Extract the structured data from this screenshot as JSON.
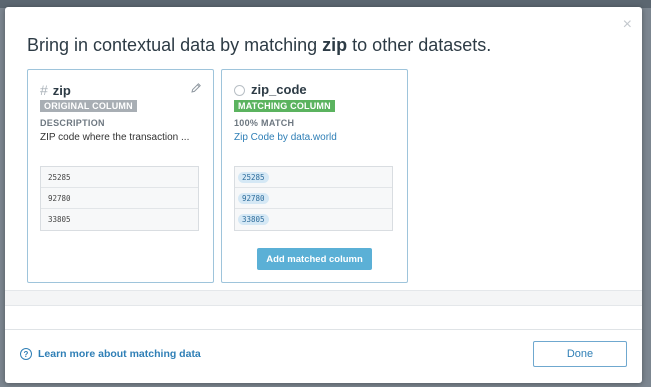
{
  "modal": {
    "close_glyph": "×",
    "title_pre": "Bring in contextual data by matching ",
    "title_field": "zip",
    "title_post": " to other datasets."
  },
  "original": {
    "name": "zip",
    "type_glyph": "#",
    "badge": "ORIGINAL COLUMN",
    "meta_label": "DESCRIPTION",
    "meta_value": "ZIP code where the transaction ...",
    "values": [
      "25285",
      "92780",
      "33805"
    ]
  },
  "matching": {
    "name": "zip_code",
    "badge": "MATCHING COLUMN",
    "meta_label": "100% MATCH",
    "source_link": "Zip Code by data.world",
    "values": [
      "25285",
      "92780",
      "33805"
    ],
    "add_button": "Add matched column"
  },
  "footer": {
    "learn_icon": "?",
    "learn_link": "Learn more about matching data",
    "done_button": "Done"
  },
  "colors": {
    "accent": "#5bb0d6",
    "link": "#2f7fb6",
    "badge_grey": "#a8aeb4",
    "badge_green": "#5bb35f",
    "card_border": "#9ec4db"
  },
  "icons": {
    "type": "hash-icon",
    "edit": "pencil-icon",
    "source": "globe-icon",
    "help": "question-circle-icon",
    "close": "close-icon"
  }
}
